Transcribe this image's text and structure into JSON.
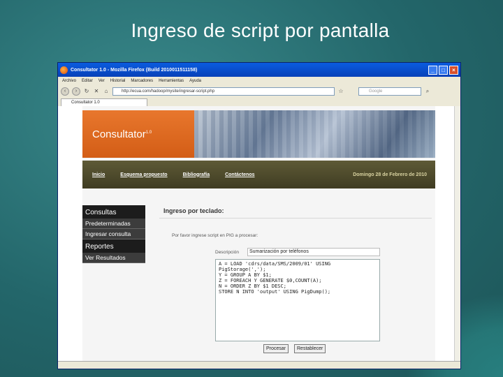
{
  "slide": {
    "title": "Ingreso de script por pantalla"
  },
  "browser": {
    "window_title": "Consultator 1.0 - Mozilla Firefox (Build 2010011511158)",
    "menu": [
      "Archivo",
      "Editar",
      "Ver",
      "Historial",
      "Marcadores",
      "Herramientas",
      "Ayuda"
    ],
    "url": "http://ecua.com/hadoop/mysite/ingresar-script.php",
    "search_placeholder": "Google",
    "tab_label": "Consultator 1.0"
  },
  "site": {
    "brand": "Consultator",
    "brand_version": "1.0",
    "nav": [
      "Inicio",
      "Esquema propuesto",
      "Bibliografía",
      "Contáctenos"
    ],
    "date": "Domingo 28 de Febrero de 2010",
    "sidebar": {
      "consultas_title": "Consultas",
      "consultas_items": [
        "Predeterminadas",
        "Ingresar consulta"
      ],
      "reportes_title": "Reportes",
      "reportes_items": [
        "Ver Resultados"
      ]
    },
    "content": {
      "title": "Ingreso por teclado:",
      "prompt": "Por favor ingrese script en PIG a procesar:",
      "desc_label": "Descripción",
      "desc_value": "Sumarización por teléfonos",
      "script": "A = LOAD 'cdrs/data/SMS/2009/01' USING\nPigStorage(',');\nY = GROUP A BY $1;\nZ = FOREACH Y GENERATE $0,COUNT(A);\nN = ORDER Z BY $1 DESC;\nSTORE N INTO 'output' USING PigDump();",
      "submit": "Procesar",
      "reset": "Restablecer"
    }
  }
}
